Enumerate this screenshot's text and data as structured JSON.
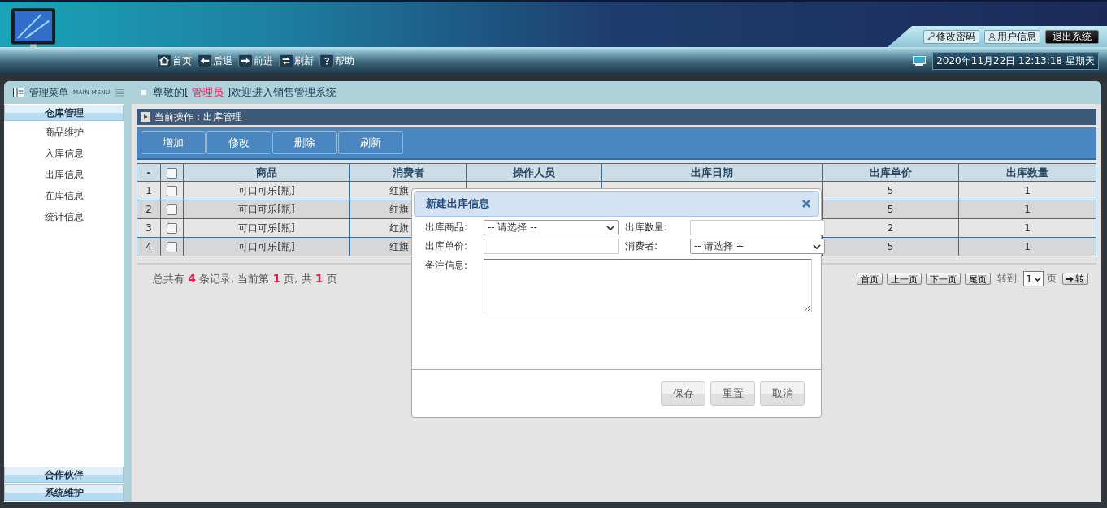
{
  "header": {
    "links": [
      {
        "kind": "key",
        "label": "修改密码"
      },
      {
        "kind": "user",
        "label": "用户信息"
      },
      {
        "kind": "exit",
        "label": "退出系统"
      }
    ]
  },
  "nav": {
    "items": [
      {
        "kind": "home",
        "label": "首页"
      },
      {
        "kind": "back",
        "label": "后退"
      },
      {
        "kind": "forward",
        "label": "前进"
      },
      {
        "kind": "refresh",
        "label": "刷新"
      },
      {
        "kind": "help",
        "label": "帮助"
      }
    ],
    "datetime": "2020年11月22日 12:13:18 星期天"
  },
  "menu": {
    "title": "管理菜单",
    "subtitle": "MAIN MENU"
  },
  "welcome": {
    "before": "尊敬的[ ",
    "role": "管理员",
    "after": " ]欢迎进入销售管理系统"
  },
  "sidebar": {
    "groups": [
      {
        "label": "仓库管理",
        "items": [
          "商品维护",
          "入库信息",
          "出库信息",
          "在库信息",
          "统计信息"
        ]
      },
      {
        "label": "合作伙伴"
      },
      {
        "label": "系统维护"
      }
    ]
  },
  "current_operation": "当前操作：出库管理",
  "toolbar": [
    "增加",
    "修改",
    "删除",
    "刷新"
  ],
  "table": {
    "columns": [
      "-",
      "",
      "商品",
      "消费者",
      "操作人员",
      "出库日期",
      "出库单价",
      "出库数量"
    ],
    "header_checked": false,
    "rows": [
      {
        "no": "1",
        "checked": false,
        "product": "可口可乐[瓶]",
        "consumer": "红旗",
        "price": "5",
        "qty": "1"
      },
      {
        "no": "2",
        "checked": false,
        "product": "可口可乐[瓶]",
        "consumer": "红旗",
        "price": "5",
        "qty": "1"
      },
      {
        "no": "3",
        "checked": false,
        "product": "可口可乐[瓶]",
        "consumer": "红旗",
        "price": "2",
        "qty": "1"
      },
      {
        "no": "4",
        "checked": false,
        "product": "可口可乐[瓶]",
        "consumer": "红旗",
        "price": "5",
        "qty": "1"
      }
    ]
  },
  "pagination": {
    "summary": "总共有 **4** 条记录, 当前第 **1** 页, 共 **1** 页",
    "buttons": [
      "首页",
      "上一页",
      "下一页",
      "尾页"
    ],
    "goto_label": "转到",
    "page": "1",
    "page_suffix": "页",
    "go": "转"
  },
  "dialog": {
    "title": "新建出库信息",
    "fields": [
      {
        "kind": "select",
        "label": "出库商品:",
        "value": "-- 请选择 --"
      },
      {
        "kind": "input",
        "label": "出库数量:"
      },
      {
        "kind": "input",
        "label": "出库单价:"
      },
      {
        "kind": "select",
        "label": "消费者:",
        "value": "-- 请选择 --"
      }
    ],
    "remark_label": "备注信息:",
    "buttons": [
      "保存",
      "重置",
      "取消"
    ]
  }
}
